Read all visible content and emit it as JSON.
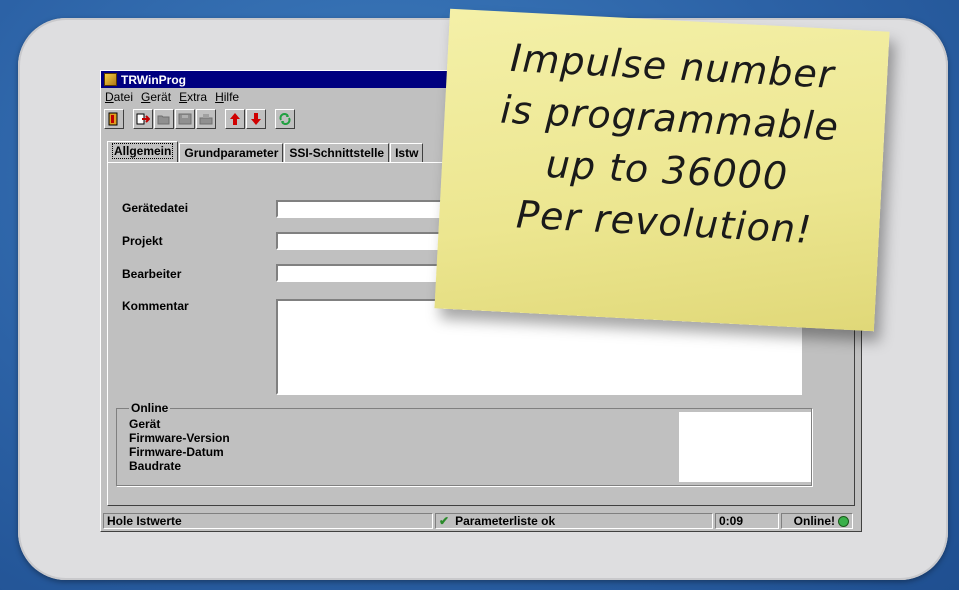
{
  "window": {
    "title": "TRWinProg"
  },
  "menu": [
    "Datei",
    "Gerät",
    "Extra",
    "Hilfe"
  ],
  "menu_underline": [
    "D",
    "G",
    "E",
    "H"
  ],
  "menu_rest": [
    "atei",
    "erät",
    "xtra",
    "ilfe"
  ],
  "toolbar": {
    "icons": [
      "exit-icon",
      "device-import-icon",
      "open-folder-icon",
      "save-disk-icon",
      "print-icon",
      "arrow-up-icon",
      "arrow-down-icon",
      "refresh-icon"
    ]
  },
  "tabs": [
    "Allgemein",
    "Grundparameter",
    "SSI-Schnittstelle",
    "Istw"
  ],
  "fields": {
    "geraetedatei": {
      "label": "Gerätedatei",
      "value": ""
    },
    "projekt": {
      "label": "Projekt",
      "value": ""
    },
    "bearbeiter": {
      "label": "Bearbeiter",
      "value": ""
    },
    "kommentar": {
      "label": "Kommentar",
      "value": ""
    }
  },
  "online_group": {
    "title": "Online",
    "lines": [
      "Gerät",
      "Firmware-Version",
      "Firmware-Datum",
      "Baudrate"
    ]
  },
  "statusbar": {
    "left": "Hole Istwerte",
    "middle": "Parameterliste ok",
    "time": "0:09",
    "online": "Online!"
  },
  "sticky_note": {
    "lines": [
      "Impulse number",
      "is programmable",
      "up to 36000",
      "Per revolution!"
    ]
  },
  "colors": {
    "titlebar": "#000080",
    "frame": "#dedee0",
    "background": "#2c62a6",
    "sticky": "#ece690"
  }
}
